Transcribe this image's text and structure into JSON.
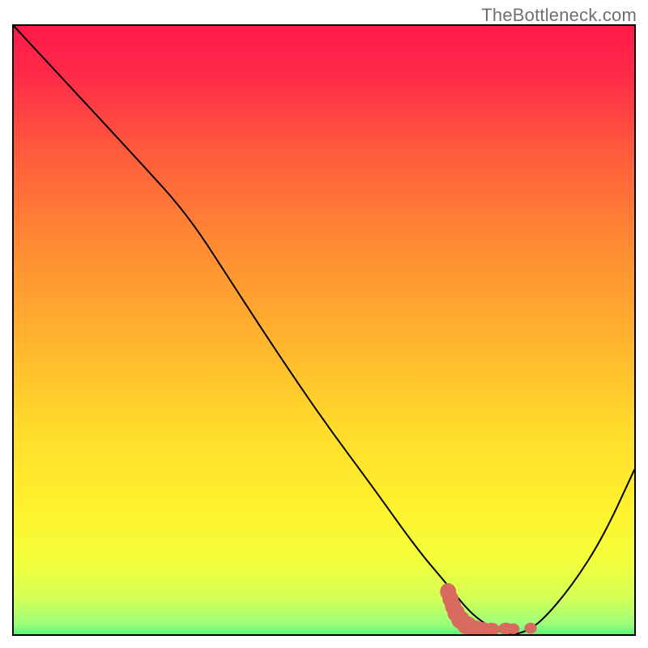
{
  "watermark": "TheBottleneck.com",
  "chart_data": {
    "type": "line",
    "title": "",
    "xlabel": "",
    "ylabel": "",
    "xlim": [
      0,
      100
    ],
    "ylim": [
      0,
      100
    ],
    "grid": false,
    "legend": false,
    "series": [
      {
        "name": "curve",
        "x": [
          0,
          10,
          20,
          28,
          35,
          42,
          50,
          58,
          65,
          70,
          74,
          78,
          80,
          82,
          85,
          90,
          95,
          100
        ],
        "y": [
          100,
          89,
          78,
          69,
          58,
          47,
          35,
          24,
          14,
          8,
          3,
          0.5,
          0,
          0.2,
          2,
          8,
          16,
          27
        ]
      }
    ],
    "annotations": [
      {
        "name": "marker-cluster",
        "shape": "bean-worm",
        "color": "#d86a60",
        "approx_center_xy": [
          76,
          2
        ],
        "approx_extent_x": [
          70,
          84
        ],
        "approx_extent_y": [
          0.5,
          7
        ]
      }
    ],
    "background_gradient": {
      "type": "vertical",
      "stops": [
        {
          "pos": 0.0,
          "color": "#ff1a4a"
        },
        {
          "pos": 0.08,
          "color": "#ff2a48"
        },
        {
          "pos": 0.2,
          "color": "#ff5a3c"
        },
        {
          "pos": 0.35,
          "color": "#ff8a33"
        },
        {
          "pos": 0.5,
          "color": "#ffb22e"
        },
        {
          "pos": 0.65,
          "color": "#ffdc2b"
        },
        {
          "pos": 0.78,
          "color": "#fff22e"
        },
        {
          "pos": 0.86,
          "color": "#f3ff3a"
        },
        {
          "pos": 0.92,
          "color": "#d6ff55"
        },
        {
          "pos": 0.965,
          "color": "#9bff7a"
        },
        {
          "pos": 0.985,
          "color": "#4cf07e"
        },
        {
          "pos": 1.0,
          "color": "#00d877"
        }
      ]
    }
  }
}
